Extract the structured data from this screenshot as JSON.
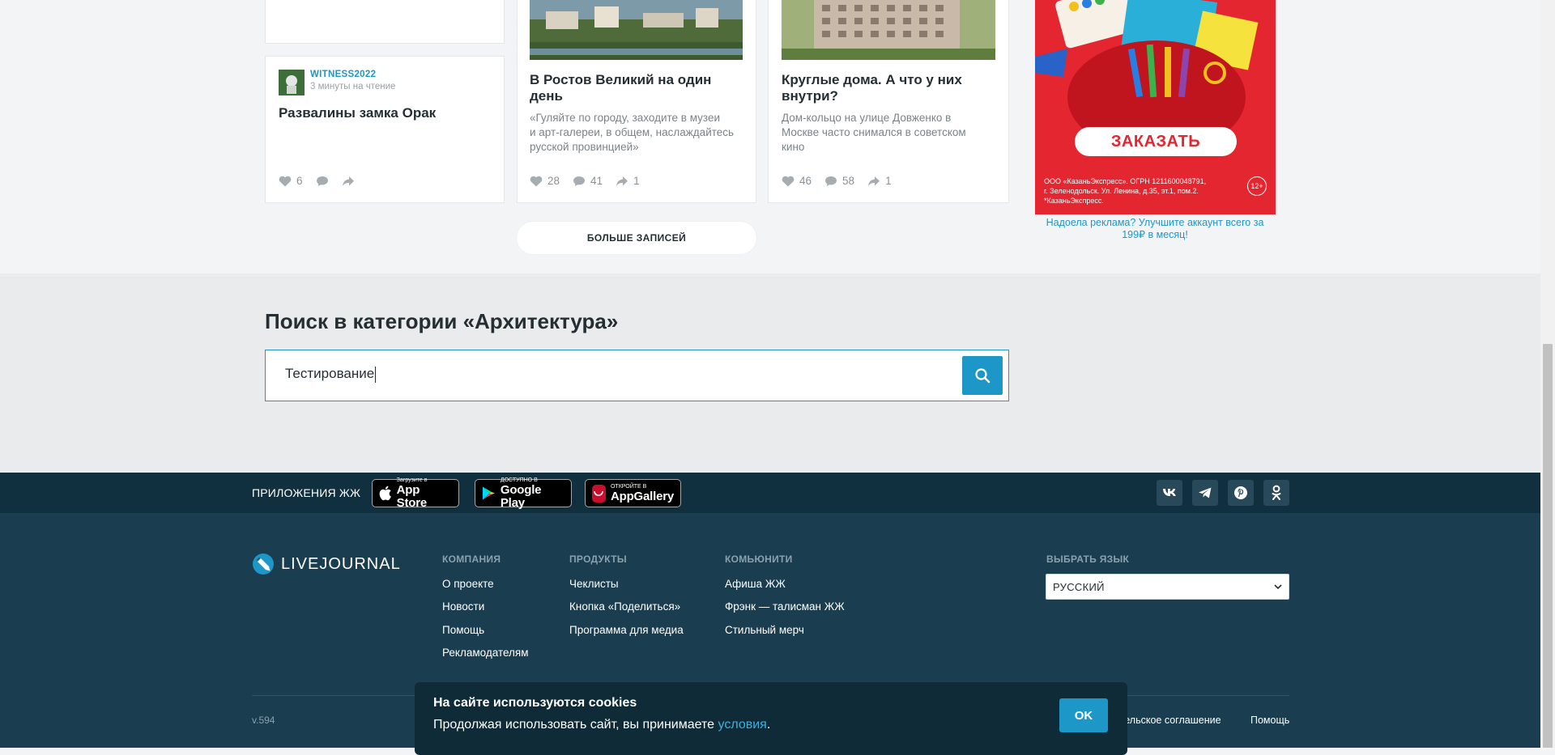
{
  "cards": [
    {
      "author": "WITNESS2022",
      "read_time": "3 минуты на чтение",
      "title": "Развалины замка Орак",
      "likes": "6"
    },
    {
      "title_line1": "В Ростов Великий на один",
      "title_line2": "день",
      "desc_line1": "«Гуляйте по городу, заходите в музеи",
      "desc_line2": "и арт-галереи, в общем, наслаждайтесь",
      "desc_line3": "русской провинцией»",
      "likes": "28",
      "comments": "41",
      "shares": "1"
    },
    {
      "title_line1": "Круглые дома. А что у них",
      "title_line2": "внутри?",
      "desc_line1": "Дом-кольцо на улице Довженко в",
      "desc_line2": "Москве часто снимался в советском",
      "desc_line3": "кино",
      "likes": "46",
      "comments": "58",
      "shares": "1"
    }
  ],
  "more_button": "БОЛЬШЕ ЗАПИСЕЙ",
  "ad": {
    "cta": "ЗАКАЗАТЬ",
    "legal_line1": "ООО «КазаньЭкспресс». ОГРН 1211600048791,",
    "legal_line2": "г. Зеленодольск. Ул. Ленина, д.35, эт.1, пом.2.",
    "legal_line3": "*КазаньЭкспресс.",
    "age": "12+",
    "upsell_line1": "Надоела реклама? Улучшите аккаунт всего за",
    "upsell_line2": "199₽ в месяц!"
  },
  "search": {
    "title": "Поиск в категории «Архитектура»",
    "value": "Тестирование"
  },
  "apps": {
    "label": "ПРИЛОЖЕНИЯ ЖЖ",
    "appstore_small": "Загрузите в",
    "appstore_big": "App Store",
    "googleplay_small": "ДОСТУПНО В",
    "googleplay_big": "Google Play",
    "appgallery_small": "ОТКРОЙТЕ В",
    "appgallery_big": "AppGallery"
  },
  "footer": {
    "logo": "LIVEJOURNAL",
    "company": {
      "heading": "КОМПАНИЯ",
      "links": [
        "О проекте",
        "Новости",
        "Помощь",
        "Рекламодателям"
      ]
    },
    "products": {
      "heading": "ПРОДУКТЫ",
      "links": [
        "Чеклисты",
        "Кнопка «Поделиться»",
        "Программа для медиа"
      ]
    },
    "community": {
      "heading": "КОМЬЮНИТИ",
      "links": [
        "Афиша ЖЖ",
        "Фрэнк — талисман ЖЖ",
        "Стильный мерч"
      ]
    },
    "language": {
      "heading": "ВЫБРАТЬ ЯЗЫК",
      "selected": "РУССКИЙ"
    },
    "version": "v.594",
    "bottom_links": [
      "ательское соглашение",
      "Помощь"
    ]
  },
  "cookie": {
    "title": "На сайте используются cookies",
    "text": "Продолжая использовать сайт, вы принимаете",
    "link": "условия",
    "period": ".",
    "ok": "OK"
  }
}
